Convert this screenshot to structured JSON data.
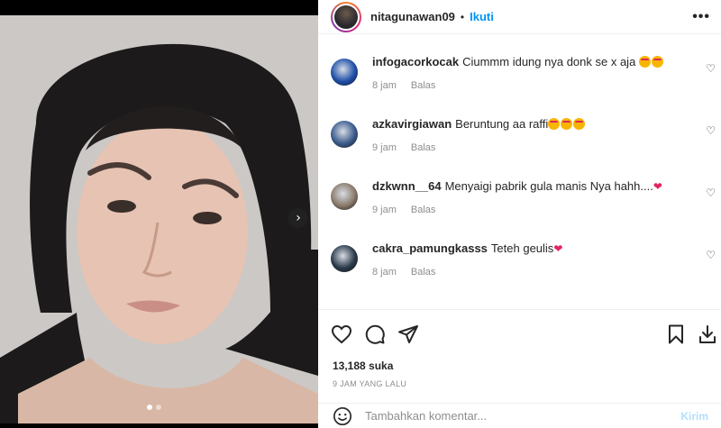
{
  "header": {
    "username": "nitagunawan09",
    "separator": "•",
    "follow_label": "Ikuti",
    "more_icon": "more-horizontal-icon"
  },
  "media": {
    "next_glyph": "›",
    "dots": 2,
    "active_dot": 0
  },
  "comments": [
    {
      "user": "infogacorkocak",
      "text": "Ciummm idung nya donk se x aja ",
      "emojis": 2,
      "hearts": 0,
      "time": "8 jam",
      "reply": "Balas",
      "avatar_color": "#1f4fa8"
    },
    {
      "user": "azkavirgiawan",
      "text": "Beruntung aa raffi",
      "emojis": 3,
      "hearts": 0,
      "time": "9 jam",
      "reply": "Balas",
      "avatar_color": "#3b5b8c"
    },
    {
      "user": "dzkwnn__64",
      "text": "Menyaigi pabrik gula manis Nya hahh....",
      "emojis": 0,
      "hearts": 1,
      "time": "9 jam",
      "reply": "Balas",
      "avatar_color": "#8a7a6a"
    },
    {
      "user": "cakra_pamungkasss",
      "text": "Teteh geulis",
      "emojis": 0,
      "hearts": 1,
      "time": "8 jam",
      "reply": "Balas",
      "avatar_color": "#2a3a4a"
    }
  ],
  "stats": {
    "likes": "13,188 suka",
    "time_ago": "9 JAM YANG LALU"
  },
  "add_comment": {
    "placeholder": "Tambahkan komentar...",
    "post_label": "Kirim"
  },
  "colors": {
    "accent": "#0095f6",
    "post_disabled": "#b2dffc",
    "heart": "#e0245e",
    "muted": "#8e8e8e"
  }
}
